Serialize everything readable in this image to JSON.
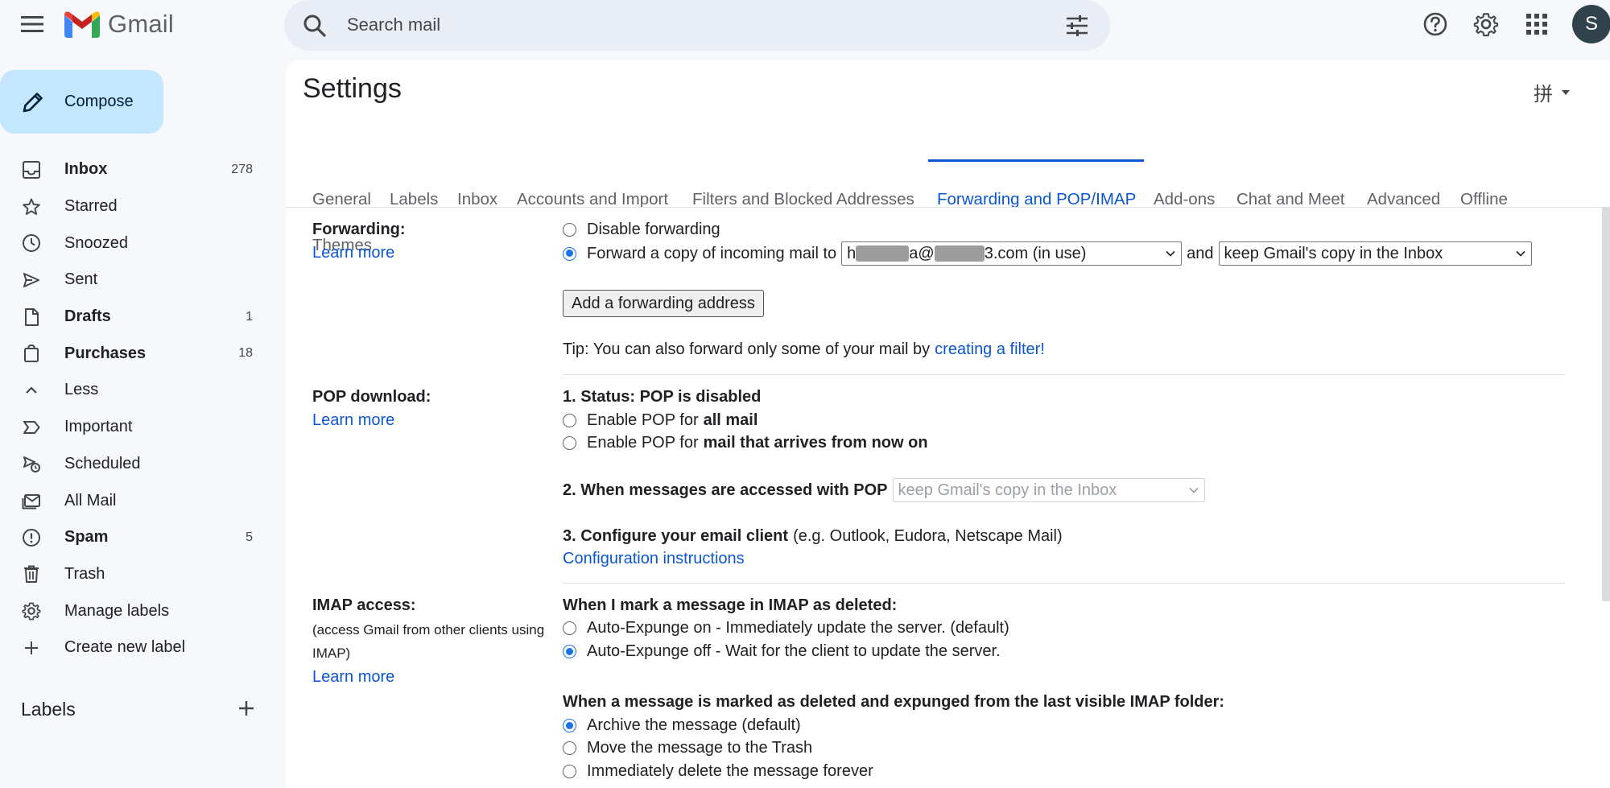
{
  "app": {
    "name": "Gmail",
    "brand_colors": {
      "red": "#ea4335",
      "blue": "#4285f4",
      "green": "#34a853",
      "yellow": "#fbbc04",
      "active_blue": "#0b57d0"
    }
  },
  "search": {
    "placeholder": "Search mail"
  },
  "account": {
    "avatar_letter": "S"
  },
  "compose": {
    "label": "Compose"
  },
  "sidebar": {
    "items": [
      {
        "label": "Inbox",
        "count": "278",
        "bold": true,
        "icon": "inbox-icon"
      },
      {
        "label": "Starred",
        "count": "",
        "bold": false,
        "icon": "star-icon"
      },
      {
        "label": "Snoozed",
        "count": "",
        "bold": false,
        "icon": "clock-icon"
      },
      {
        "label": "Sent",
        "count": "",
        "bold": false,
        "icon": "send-icon"
      },
      {
        "label": "Drafts",
        "count": "1",
        "bold": true,
        "icon": "draft-icon"
      },
      {
        "label": "Purchases",
        "count": "18",
        "bold": true,
        "icon": "shopping-bag-icon"
      },
      {
        "label": "Less",
        "count": "",
        "bold": false,
        "icon": "chevron-up-icon"
      },
      {
        "label": "Important",
        "count": "",
        "bold": false,
        "icon": "label-important-icon"
      },
      {
        "label": "Scheduled",
        "count": "",
        "bold": false,
        "icon": "schedule-send-icon"
      },
      {
        "label": "All Mail",
        "count": "",
        "bold": false,
        "icon": "all-mail-icon"
      },
      {
        "label": "Spam",
        "count": "5",
        "bold": true,
        "icon": "report-icon"
      },
      {
        "label": "Trash",
        "count": "",
        "bold": false,
        "icon": "trash-icon"
      },
      {
        "label": "Manage labels",
        "count": "",
        "bold": false,
        "icon": "gear-icon"
      },
      {
        "label": "Create new label",
        "count": "",
        "bold": false,
        "icon": "plus-icon"
      }
    ],
    "labels_heading": "Labels"
  },
  "settings": {
    "title": "Settings",
    "input_tools": "拼",
    "tabs": [
      {
        "label": "General"
      },
      {
        "label": "Labels"
      },
      {
        "label": "Inbox"
      },
      {
        "label": "Accounts and Import"
      },
      {
        "label": "Filters and Blocked Addresses"
      },
      {
        "label": "Forwarding and POP/IMAP"
      },
      {
        "label": "Add-ons"
      },
      {
        "label": "Chat and Meet"
      },
      {
        "label": "Advanced"
      },
      {
        "label": "Offline"
      },
      {
        "label": "Themes"
      }
    ],
    "active_tab": "Forwarding and POP/IMAP",
    "forwarding": {
      "label": "Forwarding:",
      "learn_more": "Learn more",
      "disable_option": "Disable forwarding",
      "forward_option": "Forward a copy of incoming mail to",
      "address_prefix": "h",
      "address_mid": "a@",
      "address_suffix": "3.com (in use)",
      "and_text": "and",
      "copy_action": "keep Gmail's copy in the Inbox",
      "add_button": "Add a forwarding address",
      "tip_text": "Tip: You can also forward only some of your mail by",
      "tip_link": "creating a filter!"
    },
    "pop": {
      "label": "POP download:",
      "learn_more": "Learn more",
      "status": "1. Status: POP is disabled",
      "opt_prefix": "Enable POP for",
      "all_mail": "all mail",
      "from_now": "mail that arrives from now on",
      "when_accessed": "2. When messages are accessed with POP",
      "access_action": "keep Gmail's copy in the Inbox",
      "configure_bold": "3. Configure your email client",
      "configure_rest": "(e.g. Outlook, Eudora, Netscape Mail)",
      "config_link": "Configuration instructions"
    },
    "imap": {
      "label": "IMAP access:",
      "note": "(access Gmail from other clients using IMAP)",
      "learn_more": "Learn more",
      "deleted_heading": "When I mark a message in IMAP as deleted:",
      "auto_on": "Auto-Expunge on - Immediately update the server. (default)",
      "auto_off": "Auto-Expunge off - Wait for the client to update the server.",
      "expunged_heading": "When a message is marked as deleted and expunged from the last visible IMAP folder:",
      "archive": "Archive the message (default)",
      "move_trash": "Move the message to the Trash",
      "delete_forever": "Immediately delete the message forever"
    }
  }
}
